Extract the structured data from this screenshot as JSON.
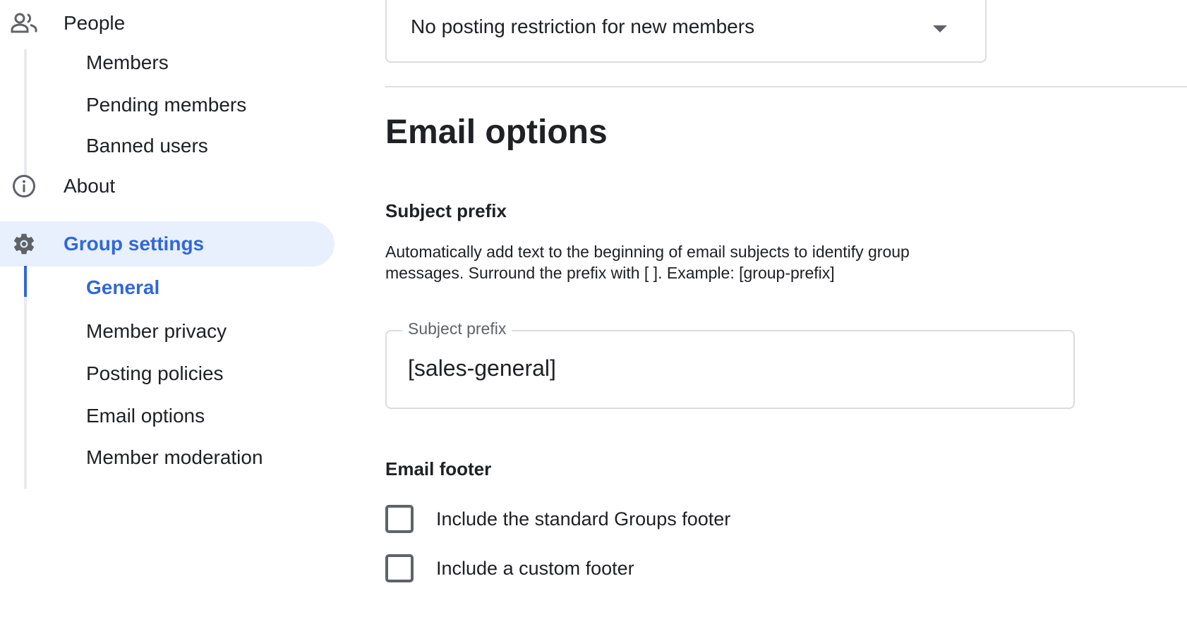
{
  "sidebar": {
    "people": {
      "label": "People",
      "icon": "people-icon"
    },
    "people_items": [
      {
        "label": "Members"
      },
      {
        "label": "Pending members"
      },
      {
        "label": "Banned users"
      }
    ],
    "about": {
      "label": "About",
      "icon": "info-icon"
    },
    "group_settings": {
      "label": "Group settings",
      "icon": "gear-icon",
      "active": true
    },
    "settings_items": [
      {
        "label": "General",
        "active": true
      },
      {
        "label": "Member privacy"
      },
      {
        "label": "Posting policies"
      },
      {
        "label": "Email options"
      },
      {
        "label": "Member moderation"
      }
    ]
  },
  "main": {
    "new_member_restriction": {
      "selected": "No posting restriction for new members"
    },
    "section_title": "Email options",
    "subject_prefix": {
      "heading": "Subject prefix",
      "description_line1": "Automatically add text to the beginning of email subjects to identify group",
      "description_line2": "messages. Surround the prefix with [ ]. Example: [group-prefix]",
      "field_label": "Subject prefix",
      "value": "[sales-general]"
    },
    "email_footer": {
      "heading": "Email footer",
      "options": [
        {
          "label": "Include the standard Groups footer",
          "checked": false
        },
        {
          "label": "Include a custom footer",
          "checked": false
        }
      ]
    }
  },
  "colors": {
    "accent": "#3367d6",
    "active_bg": "#e8f0fe",
    "border": "#dadce0",
    "icon": "#5f6368"
  }
}
